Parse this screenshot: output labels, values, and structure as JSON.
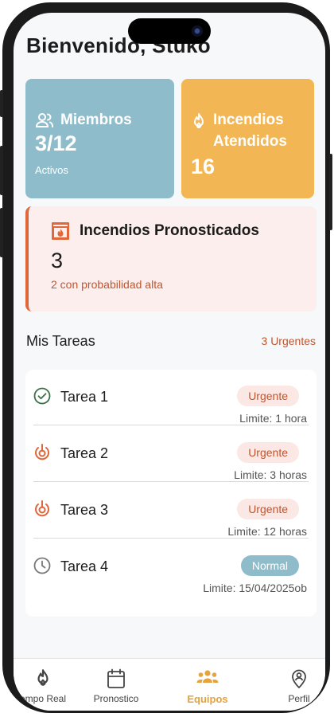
{
  "header": {
    "greeting": "Bienvenido, Stuko"
  },
  "cards": {
    "members": {
      "label": "Miembros",
      "value": "3/12",
      "sub": "Activos",
      "color": "#8fbccb"
    },
    "fires_attended": {
      "label": "Incendios Atendidos",
      "value": "16",
      "color": "#f2b654"
    },
    "forecast": {
      "label": "Incendios Pronosticados",
      "value": "3",
      "sub": "2 con probabilidad alta",
      "accent": "#e0673a"
    }
  },
  "tasks": {
    "title": "Mis Tareas",
    "urgent_count": "3 Urgentes",
    "items": [
      {
        "name": "Tarea 1",
        "badge": "Urgente",
        "limit": "Limite: 1 hora",
        "icon": "check-circle-icon"
      },
      {
        "name": "Tarea 2",
        "badge": "Urgente",
        "limit": "Limite: 3 horas",
        "icon": "alarm-icon"
      },
      {
        "name": "Tarea 3",
        "badge": "Urgente",
        "limit": "Limite: 12 horas",
        "icon": "alarm-icon"
      },
      {
        "name": "Tarea 4",
        "badge": "Normal",
        "limit": "Limite: 15/04/2025ob",
        "icon": "clock-icon"
      }
    ]
  },
  "nav": {
    "items": [
      {
        "label": "empo Real",
        "icon": "flame-icon"
      },
      {
        "label": "Pronostico",
        "icon": "calendar-icon"
      },
      {
        "label": "Equipos",
        "icon": "team-icon",
        "active": true
      },
      {
        "label": "Perfil",
        "icon": "location-person-icon"
      }
    ]
  }
}
